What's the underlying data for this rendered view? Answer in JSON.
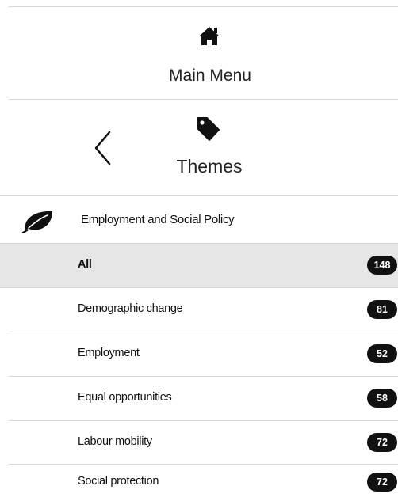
{
  "nav": {
    "main_menu": {
      "label": "Main Menu",
      "icon": "home-icon"
    },
    "current": {
      "label": "Themes",
      "icon": "tag-icon",
      "back_icon": "chevron-left-icon"
    }
  },
  "category": {
    "label": "Employment and Social Policy",
    "icon": "leaf-icon"
  },
  "items": [
    {
      "label": "All",
      "count": "148",
      "selected": true
    },
    {
      "label": "Demographic change",
      "count": "81",
      "selected": false
    },
    {
      "label": "Employment",
      "count": "52",
      "selected": false
    },
    {
      "label": "Equal opportunities",
      "count": "58",
      "selected": false
    },
    {
      "label": "Labour mobility",
      "count": "72",
      "selected": false
    },
    {
      "label": "Social protection",
      "count": "72",
      "selected": false
    }
  ],
  "colors": {
    "selected_bg": "#e6e6e6",
    "badge_bg": "#111111",
    "divider": "#d6d6d6"
  }
}
